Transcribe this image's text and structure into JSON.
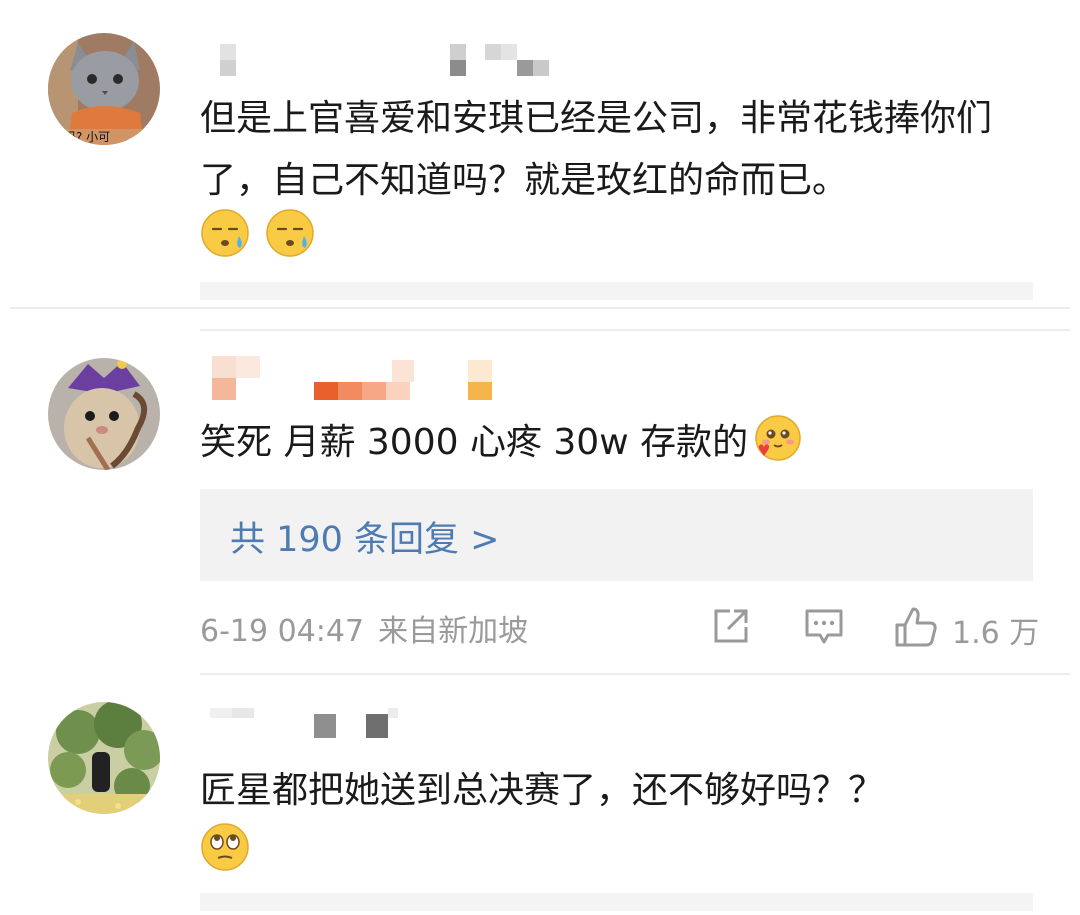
{
  "comments": [
    {
      "id": "c1",
      "author": "",
      "text": "但是上官喜爱和安琪已经是公司，非常花钱捧你们了，自己不知道吗？就是玫红的命而已。",
      "emojis": [
        "sweat-face-icon",
        "sweat-face-icon"
      ],
      "avatar": "cat-avatar"
    },
    {
      "id": "c2",
      "author": "",
      "text": "笑死 月薪 3000 心疼 30w 存款的",
      "inline_emoji": "cute-heart-face-icon",
      "avatar": "hamster-avatar",
      "reply_link": "共 190 条回复 >",
      "date": "6-19 04:47",
      "source": "来自新加坡",
      "likes": "1.6 万"
    },
    {
      "id": "c3",
      "author": "",
      "text": "匠星都把她送到总决赛了，还不够好吗？？",
      "emojis": [
        "eye-roll-face-icon"
      ],
      "avatar": "forest-avatar"
    }
  ],
  "colors": {
    "link": "#4f7bb3",
    "meta": "#9a9a9a",
    "divider": "#ececec",
    "reply_bg": "#f2f2f2"
  }
}
